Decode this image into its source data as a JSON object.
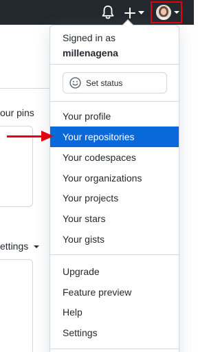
{
  "header": {
    "notifications_icon": "bell-icon",
    "create_icon": "plus-icon",
    "create_menu_icon": "caret-down-icon",
    "avatar_icon": "avatar",
    "avatar_menu_icon": "caret-down-icon",
    "highlight_color": "#e3000f"
  },
  "background": {
    "pins_label": "our pins",
    "settings_label": "ettings"
  },
  "dropdown": {
    "signed_in_as": "Signed in as",
    "username": "millenagena",
    "set_status": "Set status",
    "status_icon": "smiley-icon",
    "section_1": [
      {
        "label": "Your profile"
      },
      {
        "label": "Your repositories",
        "active": true
      },
      {
        "label": "Your codespaces"
      },
      {
        "label": "Your organizations"
      },
      {
        "label": "Your projects"
      },
      {
        "label": "Your stars"
      },
      {
        "label": "Your gists"
      }
    ],
    "section_2": [
      {
        "label": "Upgrade"
      },
      {
        "label": "Feature preview"
      },
      {
        "label": "Help"
      },
      {
        "label": "Settings"
      }
    ],
    "active_color": "#0969da"
  },
  "annotation": {
    "arrow_icon": "red-arrow-icon",
    "arrow_color": "#e3000f"
  }
}
